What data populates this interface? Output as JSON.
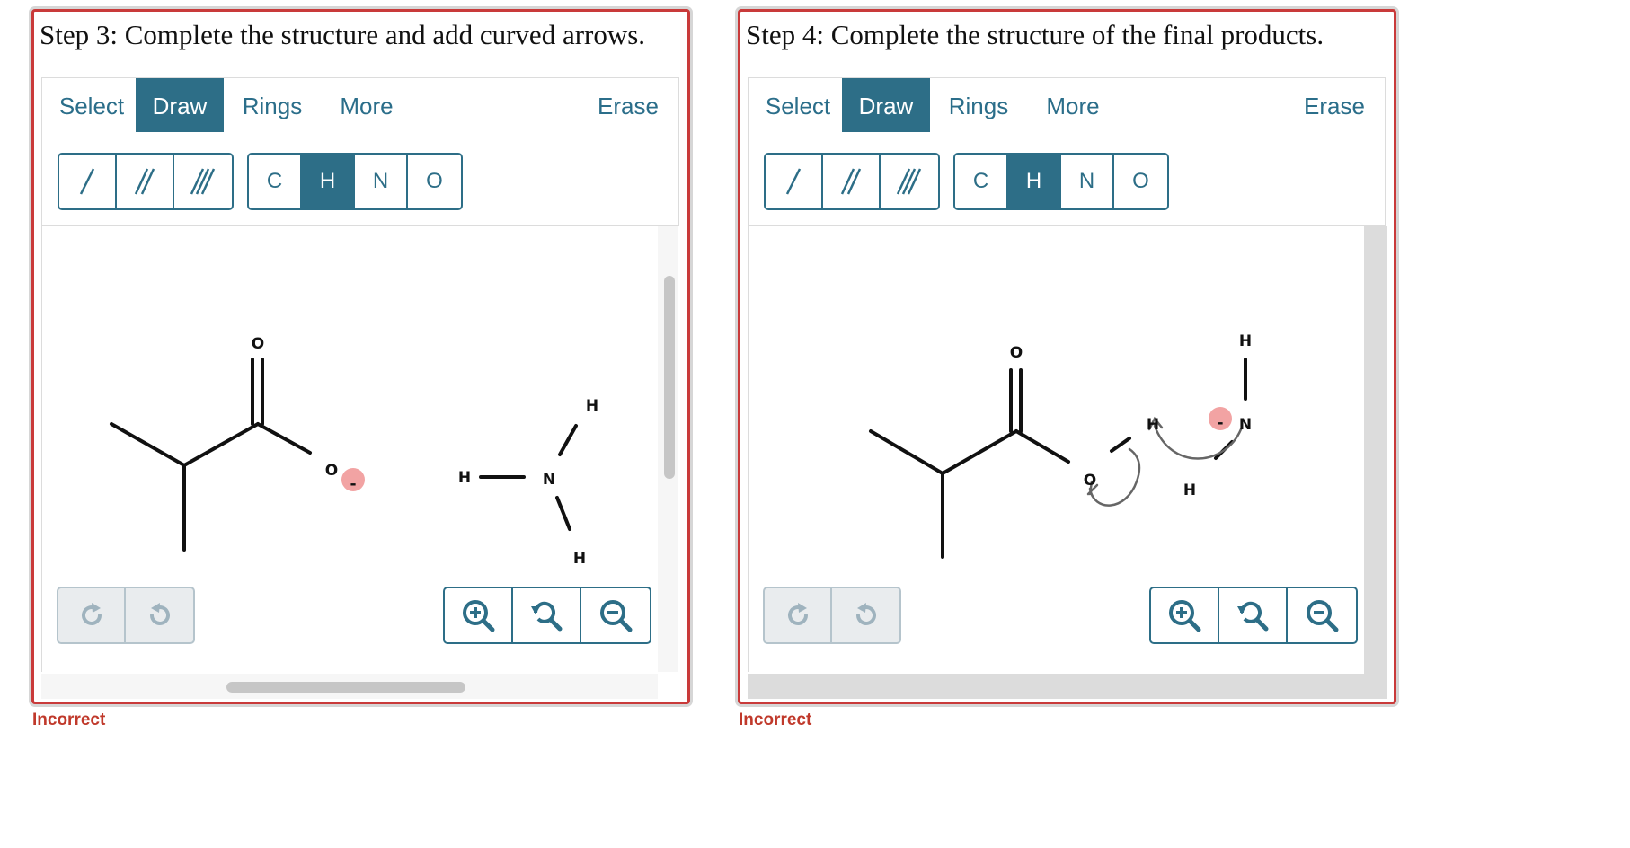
{
  "panels": [
    {
      "title": "Step 3: Complete the structure and add curved arrows.",
      "tabs": {
        "select": "Select",
        "draw": "Draw",
        "rings": "Rings",
        "more": "More",
        "erase": "Erase"
      },
      "atoms": {
        "c": "C",
        "h": "H",
        "n": "N",
        "o": "O"
      },
      "active_tab": "Draw",
      "active_atom": "H",
      "molecule_labels": {
        "carbonyl_o": "O",
        "alkoxide_o": "O",
        "charge": "-",
        "n": "N",
        "h_top": "H",
        "h_left": "H",
        "h_bottom": "H"
      },
      "feedback": "Incorrect"
    },
    {
      "title": "Step 4: Complete the structure of the final products.",
      "tabs": {
        "select": "Select",
        "draw": "Draw",
        "rings": "Rings",
        "more": "More",
        "erase": "Erase"
      },
      "atoms": {
        "c": "C",
        "h": "H",
        "n": "N",
        "o": "O"
      },
      "active_tab": "Draw",
      "active_atom": "H",
      "molecule_labels": {
        "carbonyl_o": "O",
        "o_with_h": "O",
        "h_transfer": "H",
        "n": "N",
        "charge": "-",
        "h_top": "H",
        "h_bottom": "H"
      },
      "feedback": "Incorrect"
    }
  ],
  "colors": {
    "accent": "#2d6e87",
    "error": "#c0392b",
    "panel_border": "#c93a3a",
    "charge_badge": "#f2a3a3"
  },
  "icons": {
    "redo": "redo-icon",
    "undo": "undo-icon",
    "zoom_in": "zoom-in-icon",
    "zoom_reset": "zoom-reset-icon",
    "zoom_out": "zoom-out-icon"
  }
}
